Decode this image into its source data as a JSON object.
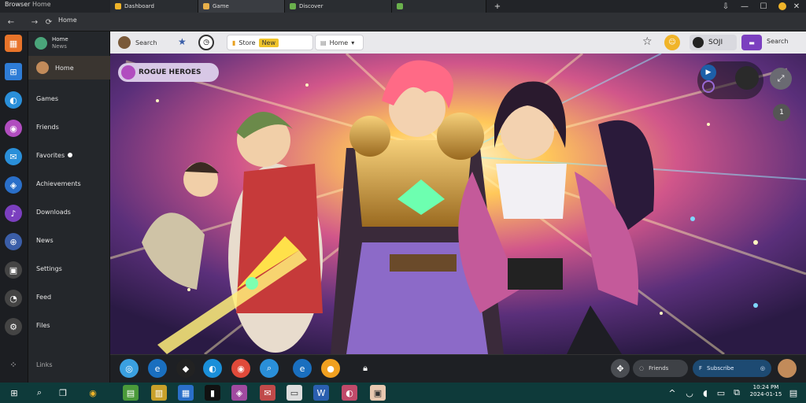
{
  "window": {
    "app_name": "Browser",
    "app_subtitle": "Home",
    "tabs": [
      {
        "label": "Dashboard",
        "color": "#f0b429"
      },
      {
        "label": "Game",
        "color": "#e8b04a"
      },
      {
        "label": "Discover",
        "color": "#6ab04c"
      }
    ],
    "new_tab_label": "+"
  },
  "toolbar": {
    "back_label": "←",
    "forward_label": "→",
    "home_label": "Home",
    "sidebar_top_a": "Home",
    "sidebar_top_b": "News"
  },
  "address": {
    "site_label": "Search",
    "filter_label": "Store",
    "filter_badge": "New",
    "dropdown_label": "Home",
    "profile_label": "SOJI",
    "action_label": "Search"
  },
  "sidebar": {
    "items": [
      {
        "label": "Home"
      },
      {
        "label": "Games"
      },
      {
        "label": "Friends"
      },
      {
        "label": "Favorites"
      },
      {
        "label": "Achievements"
      },
      {
        "label": "Downloads"
      },
      {
        "label": "News"
      },
      {
        "label": "Settings"
      },
      {
        "label": "Feed"
      },
      {
        "label": "Files"
      }
    ],
    "footer_label": "Links"
  },
  "banner": {
    "badge_text": "ROGUE HEROES",
    "notif_count": "1"
  },
  "bottombar": {
    "button_a": "Friends",
    "button_b": "Subscribe"
  },
  "taskbar": {
    "time": "10:24 PM",
    "date": "2024-01-15"
  }
}
